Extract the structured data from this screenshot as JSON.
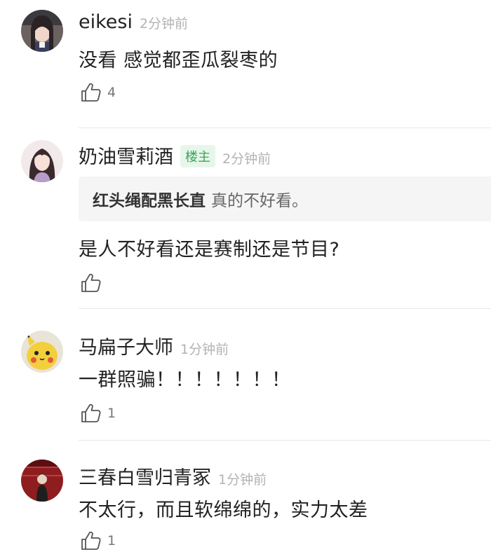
{
  "comments": [
    {
      "username": "eikesi",
      "time": "2分钟前",
      "text": "没看 感觉都歪瓜裂枣的",
      "likes": "4"
    },
    {
      "username": "奶油雪莉酒",
      "badge": "楼主",
      "time": "2分钟前",
      "quote_name": "红头绳配黑长直",
      "quote_text": "真的不好看。",
      "text": "是人不好看还是赛制还是节目?",
      "likes": ""
    },
    {
      "username": "马扁子大师",
      "time": "1分钟前",
      "text": "一群照骗！！！！！！！",
      "likes": "1"
    },
    {
      "username": "三春白雪归青冢",
      "time": "1分钟前",
      "text": "不太行，而且软绵绵的，实力太差",
      "likes": "1"
    }
  ],
  "colors": {
    "badge_green": "#3aa55b",
    "time_gray": "#b3b3b3",
    "quote_bg": "#f5f5f5"
  },
  "icons": {
    "like": "thumbs-up-icon"
  }
}
